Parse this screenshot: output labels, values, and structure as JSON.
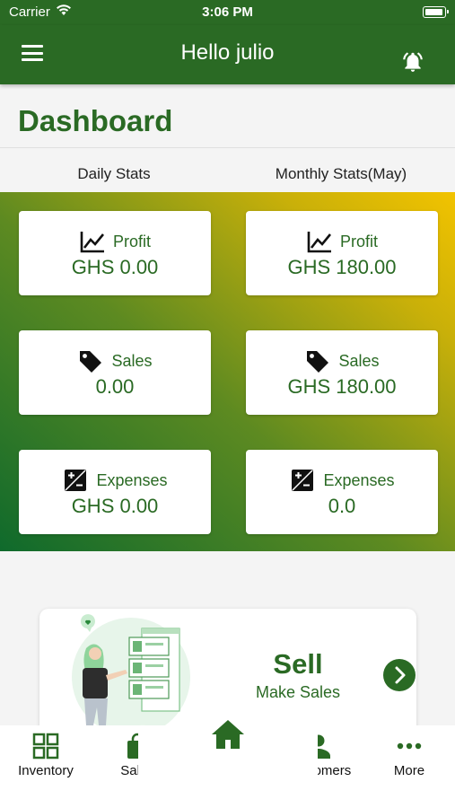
{
  "status_bar": {
    "carrier": "Carrier",
    "time": "3:06 PM"
  },
  "header": {
    "title": "Hello julio"
  },
  "page_title": "Dashboard",
  "columns": {
    "daily": "Daily Stats",
    "monthly": "Monthly Stats(May)"
  },
  "daily": {
    "profit": {
      "label": "Profit",
      "value": "GHS 0.00"
    },
    "sales": {
      "label": "Sales",
      "value": "0.00"
    },
    "expenses": {
      "label": "Expenses",
      "value": "GHS 0.00"
    }
  },
  "monthly": {
    "profit": {
      "label": "Profit",
      "value": "GHS 180.00"
    },
    "sales": {
      "label": "Sales",
      "value": "GHS 180.00"
    },
    "expenses": {
      "label": "Expenses",
      "value": "0.0"
    }
  },
  "sell_card": {
    "title": "Sell",
    "subtitle": "Make Sales"
  },
  "tabs": [
    {
      "label": "Inventory",
      "icon": "grid-icon"
    },
    {
      "label": "Sales",
      "icon": "bag-icon"
    },
    {
      "label": "",
      "icon": "home-icon"
    },
    {
      "label": "Customers",
      "icon": "person-icon"
    },
    {
      "label": "More",
      "icon": "dots-icon"
    }
  ],
  "colors": {
    "brand_green": "#2a6a24",
    "gradient_start": "#0f6a2c",
    "gradient_end": "#f2c300"
  }
}
